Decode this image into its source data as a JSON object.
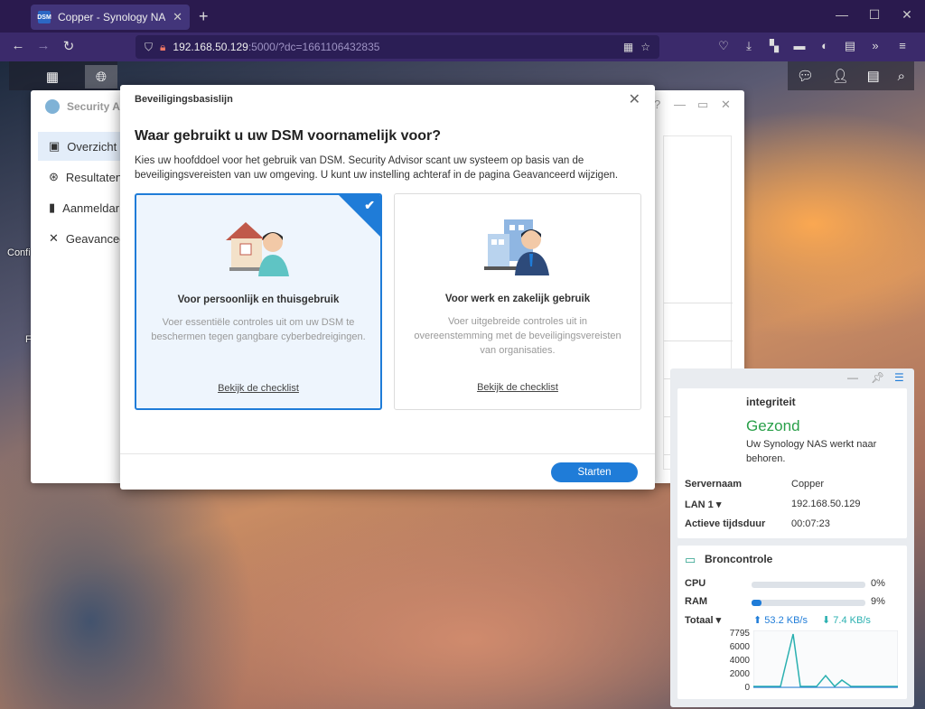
{
  "browser": {
    "tab_favicon": "DSM",
    "tab_title": "Copper - Synology NAS",
    "url_host": "192.168.50.129",
    "url_rest": ":5000/?dc=1661106432835"
  },
  "desktop": {
    "labels": [
      "Confi",
      "F"
    ]
  },
  "app": {
    "title": "Security Ad",
    "sidebar": [
      "Overzicht",
      "Resultaten",
      "Aanmeldar",
      "Geavancee"
    ]
  },
  "widgets": {
    "health": {
      "title": "integriteit",
      "status": "Gezond",
      "desc": "Uw Synology NAS werkt naar behoren.",
      "rows": [
        {
          "key": "Servernaam",
          "value": "Copper"
        },
        {
          "key": "LAN 1 ▾",
          "value": "192.168.50.129"
        },
        {
          "key": "Actieve tijdsduur",
          "value": "00:07:23"
        }
      ]
    },
    "resource": {
      "title": "Broncontrole",
      "cpu_label": "CPU",
      "cpu_pct": "0%",
      "cpu_value": 0,
      "ram_label": "RAM",
      "ram_pct": "9%",
      "ram_value": 9,
      "total_label": "Totaal ▾",
      "upload": "53.2 KB/s",
      "download": "7.4 KB/s",
      "y_ticks": [
        "7795",
        "6000",
        "4000",
        "2000",
        "0"
      ]
    }
  },
  "modal": {
    "header": "Beveiligingsbasislijn",
    "question": "Waar gebruikt u uw DSM voornamelijk voor?",
    "description": "Kies uw hoofddoel voor het gebruik van DSM. Security Advisor scant uw systeem op basis van de beveiligingsvereisten van uw omgeving. U kunt uw instelling achteraf in de pagina Geavanceerd wijzigen.",
    "options": [
      {
        "title": "Voor persoonlijk en thuisgebruik",
        "desc": "Voer essentiële controles uit om uw DSM te beschermen tegen gangbare cyberbedreigingen.",
        "link": "Bekijk de checklist"
      },
      {
        "title": "Voor werk en zakelijk gebruik",
        "desc": "Voer uitgebreide controles uit in overeenstemming met de beveiligingsvereisten van organisaties.",
        "link": "Bekijk de checklist"
      }
    ],
    "start": "Starten"
  }
}
